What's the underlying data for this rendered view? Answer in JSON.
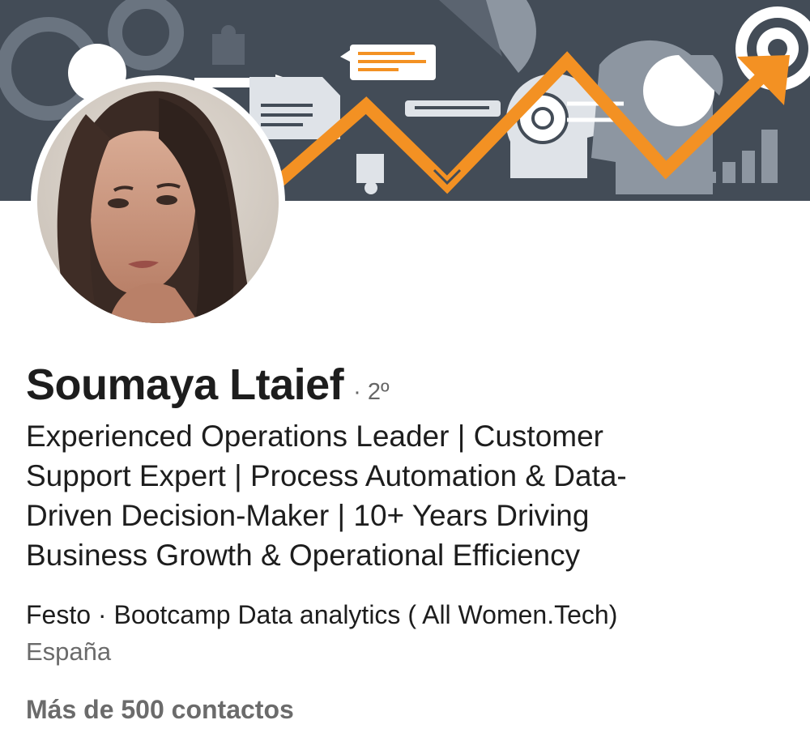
{
  "profile": {
    "name": "Soumaya Ltaief",
    "degree": "· 2º",
    "headline_lines": [
      "Experienced Operations Leader | Customer",
      "Support Expert | Process Automation & Data-",
      "Driven Decision-Maker | 10+ Years Driving",
      "Business Growth & Operational Efficiency"
    ],
    "company_education": "Festo · Bootcamp Data analytics ( All Women.Tech)",
    "location": "España",
    "connections": "Más de 500 contactos"
  },
  "banner": {
    "background": "#434c57",
    "accent": "#f39123",
    "icons": [
      "gear-icon",
      "puzzle-icon",
      "document-icon",
      "pie-chart-icon",
      "head-gear-icon",
      "target-icon",
      "bar-chart-icon",
      "trend-arrow-icon"
    ]
  },
  "colors": {
    "text": "#1d1d1d",
    "muted": "#6b6b6b"
  }
}
